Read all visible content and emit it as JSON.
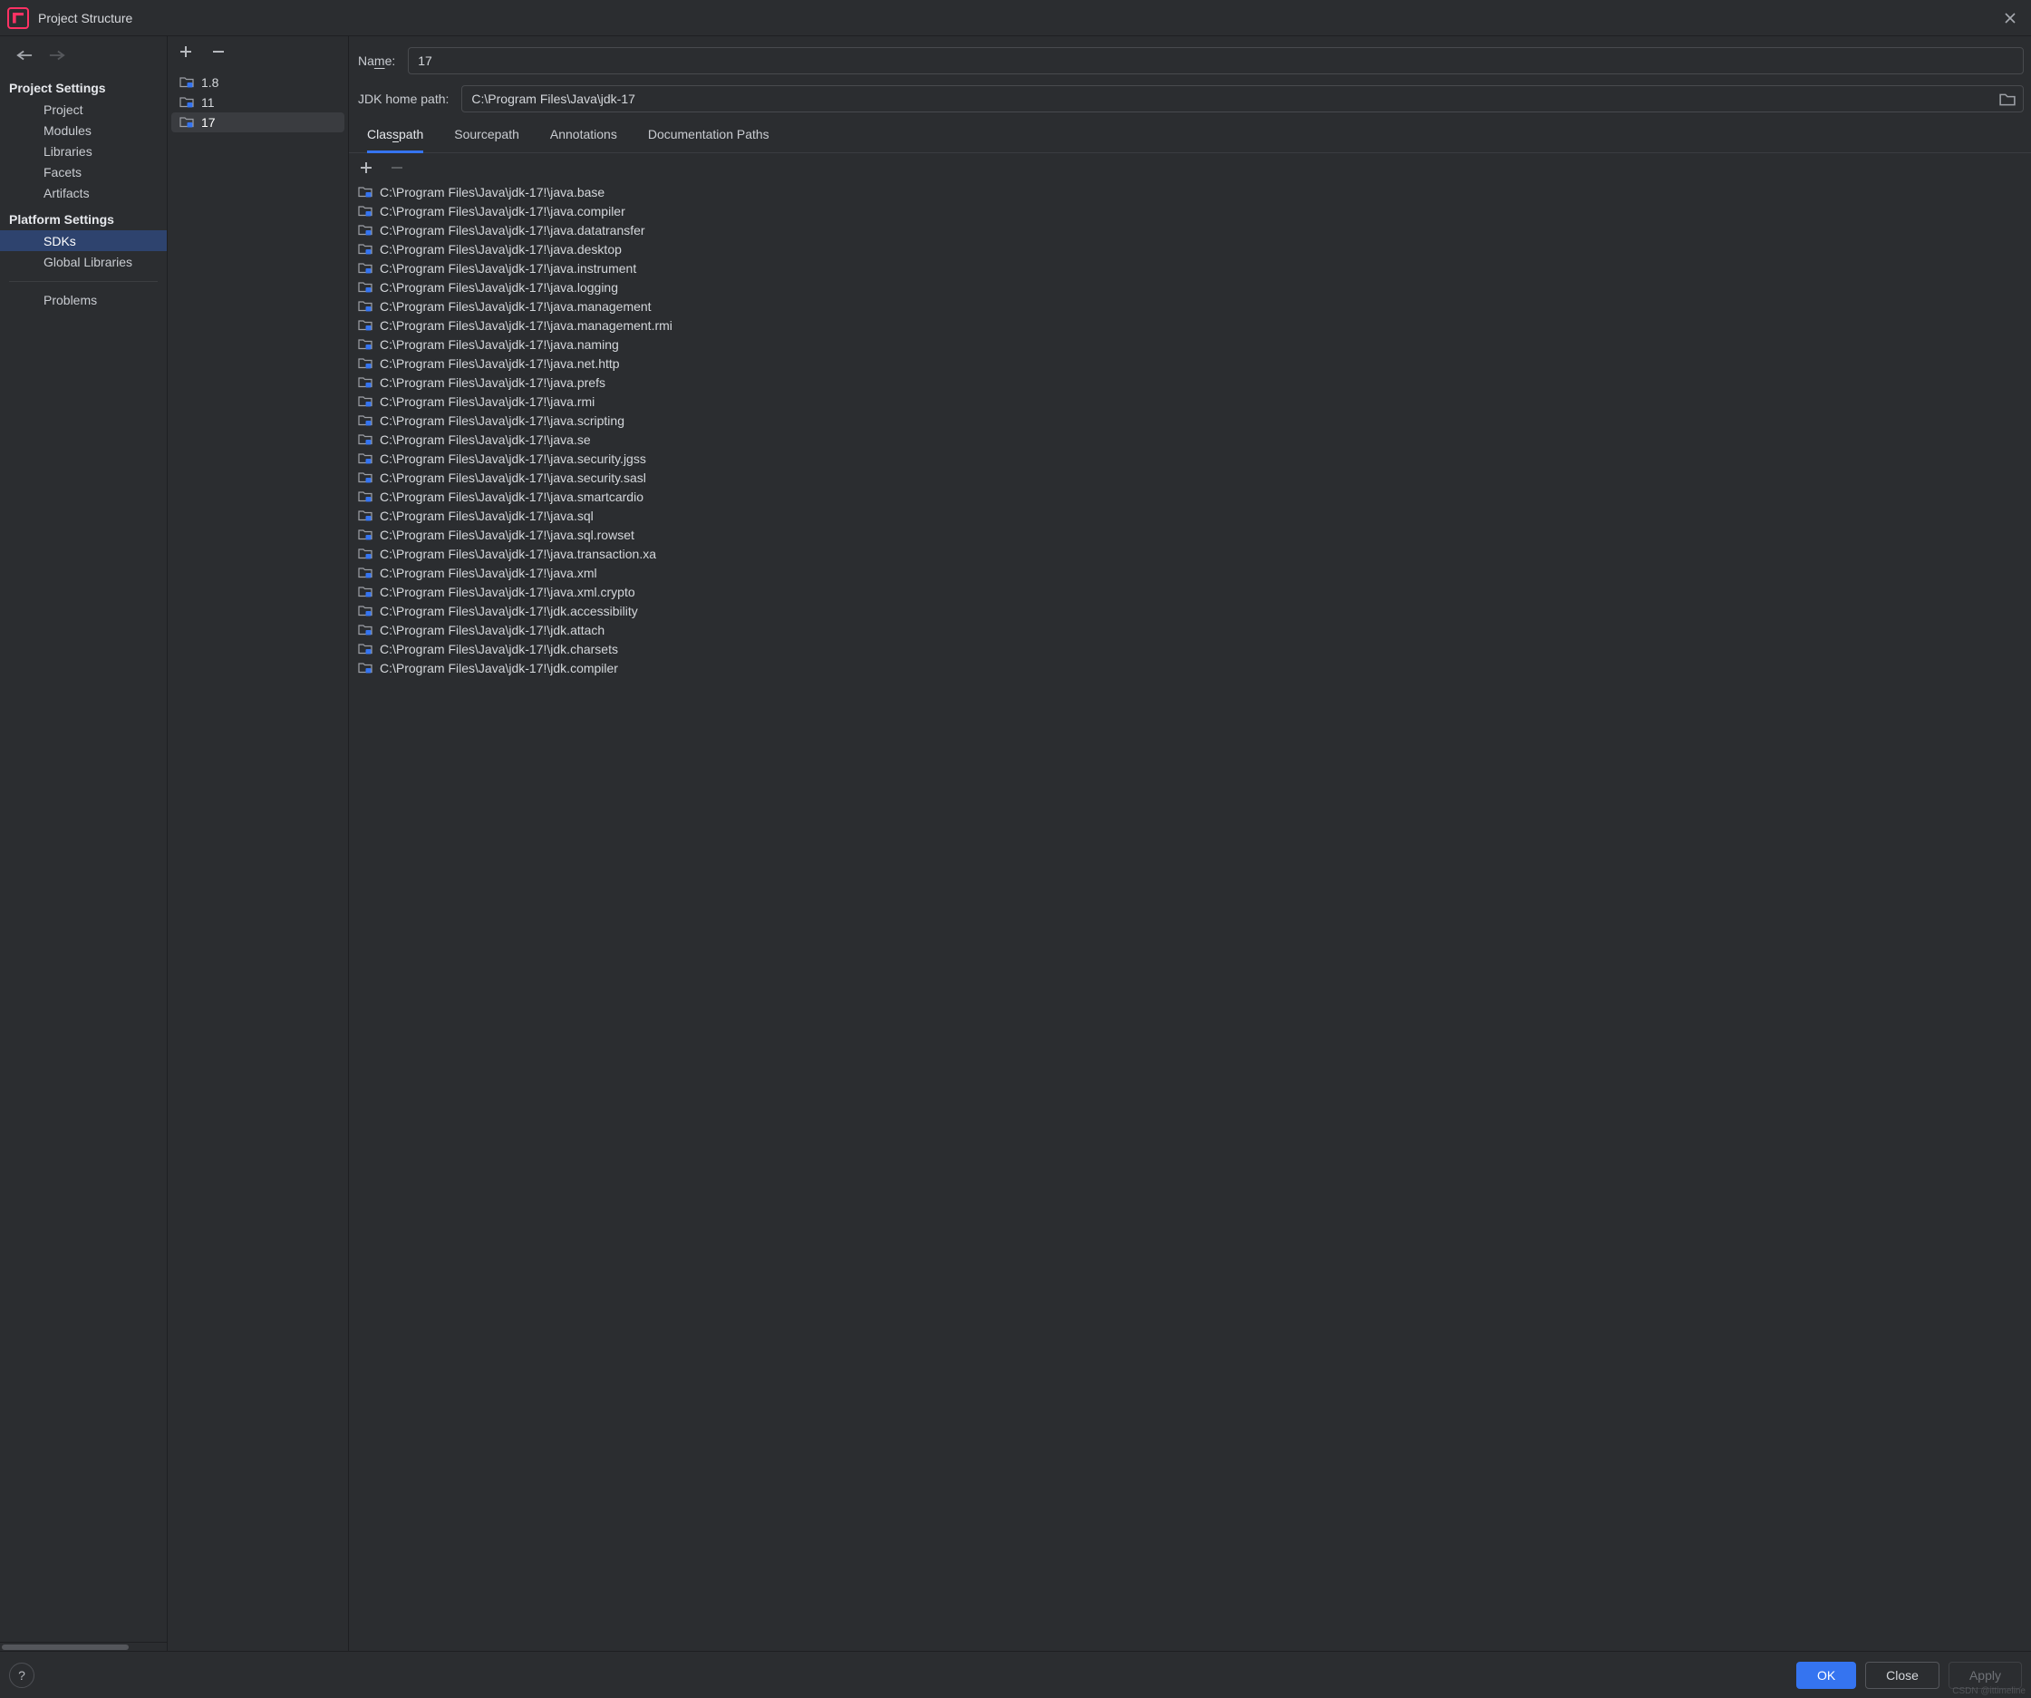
{
  "window": {
    "title": "Project Structure"
  },
  "sidebar": {
    "section1": "Project Settings",
    "items1": [
      {
        "label": "Project"
      },
      {
        "label": "Modules"
      },
      {
        "label": "Libraries"
      },
      {
        "label": "Facets"
      },
      {
        "label": "Artifacts"
      }
    ],
    "section2": "Platform Settings",
    "items2": [
      {
        "label": "SDKs"
      },
      {
        "label": "Global Libraries"
      }
    ],
    "section3items": [
      {
        "label": "Problems"
      }
    ],
    "selected": "SDKs"
  },
  "sdks": [
    {
      "label": "1.8"
    },
    {
      "label": "11"
    },
    {
      "label": "17"
    }
  ],
  "sdkSelected": "17",
  "form": {
    "nameLabel": "Name:",
    "nameValue": "17",
    "pathLabel": "JDK home path:",
    "pathValue": "C:\\Program Files\\Java\\jdk-17"
  },
  "tabs": [
    {
      "label": "Classpath",
      "underlineIndex": 4
    },
    {
      "label": "Sourcepath"
    },
    {
      "label": "Annotations"
    },
    {
      "label": "Documentation Paths"
    }
  ],
  "tabActive": "Classpath",
  "classpath": [
    "C:\\Program Files\\Java\\jdk-17!\\java.base",
    "C:\\Program Files\\Java\\jdk-17!\\java.compiler",
    "C:\\Program Files\\Java\\jdk-17!\\java.datatransfer",
    "C:\\Program Files\\Java\\jdk-17!\\java.desktop",
    "C:\\Program Files\\Java\\jdk-17!\\java.instrument",
    "C:\\Program Files\\Java\\jdk-17!\\java.logging",
    "C:\\Program Files\\Java\\jdk-17!\\java.management",
    "C:\\Program Files\\Java\\jdk-17!\\java.management.rmi",
    "C:\\Program Files\\Java\\jdk-17!\\java.naming",
    "C:\\Program Files\\Java\\jdk-17!\\java.net.http",
    "C:\\Program Files\\Java\\jdk-17!\\java.prefs",
    "C:\\Program Files\\Java\\jdk-17!\\java.rmi",
    "C:\\Program Files\\Java\\jdk-17!\\java.scripting",
    "C:\\Program Files\\Java\\jdk-17!\\java.se",
    "C:\\Program Files\\Java\\jdk-17!\\java.security.jgss",
    "C:\\Program Files\\Java\\jdk-17!\\java.security.sasl",
    "C:\\Program Files\\Java\\jdk-17!\\java.smartcardio",
    "C:\\Program Files\\Java\\jdk-17!\\java.sql",
    "C:\\Program Files\\Java\\jdk-17!\\java.sql.rowset",
    "C:\\Program Files\\Java\\jdk-17!\\java.transaction.xa",
    "C:\\Program Files\\Java\\jdk-17!\\java.xml",
    "C:\\Program Files\\Java\\jdk-17!\\java.xml.crypto",
    "C:\\Program Files\\Java\\jdk-17!\\jdk.accessibility",
    "C:\\Program Files\\Java\\jdk-17!\\jdk.attach",
    "C:\\Program Files\\Java\\jdk-17!\\jdk.charsets",
    "C:\\Program Files\\Java\\jdk-17!\\jdk.compiler"
  ],
  "footer": {
    "ok": "OK",
    "close": "Close",
    "apply": "Apply"
  },
  "watermark": "CSDN @ittimeline"
}
